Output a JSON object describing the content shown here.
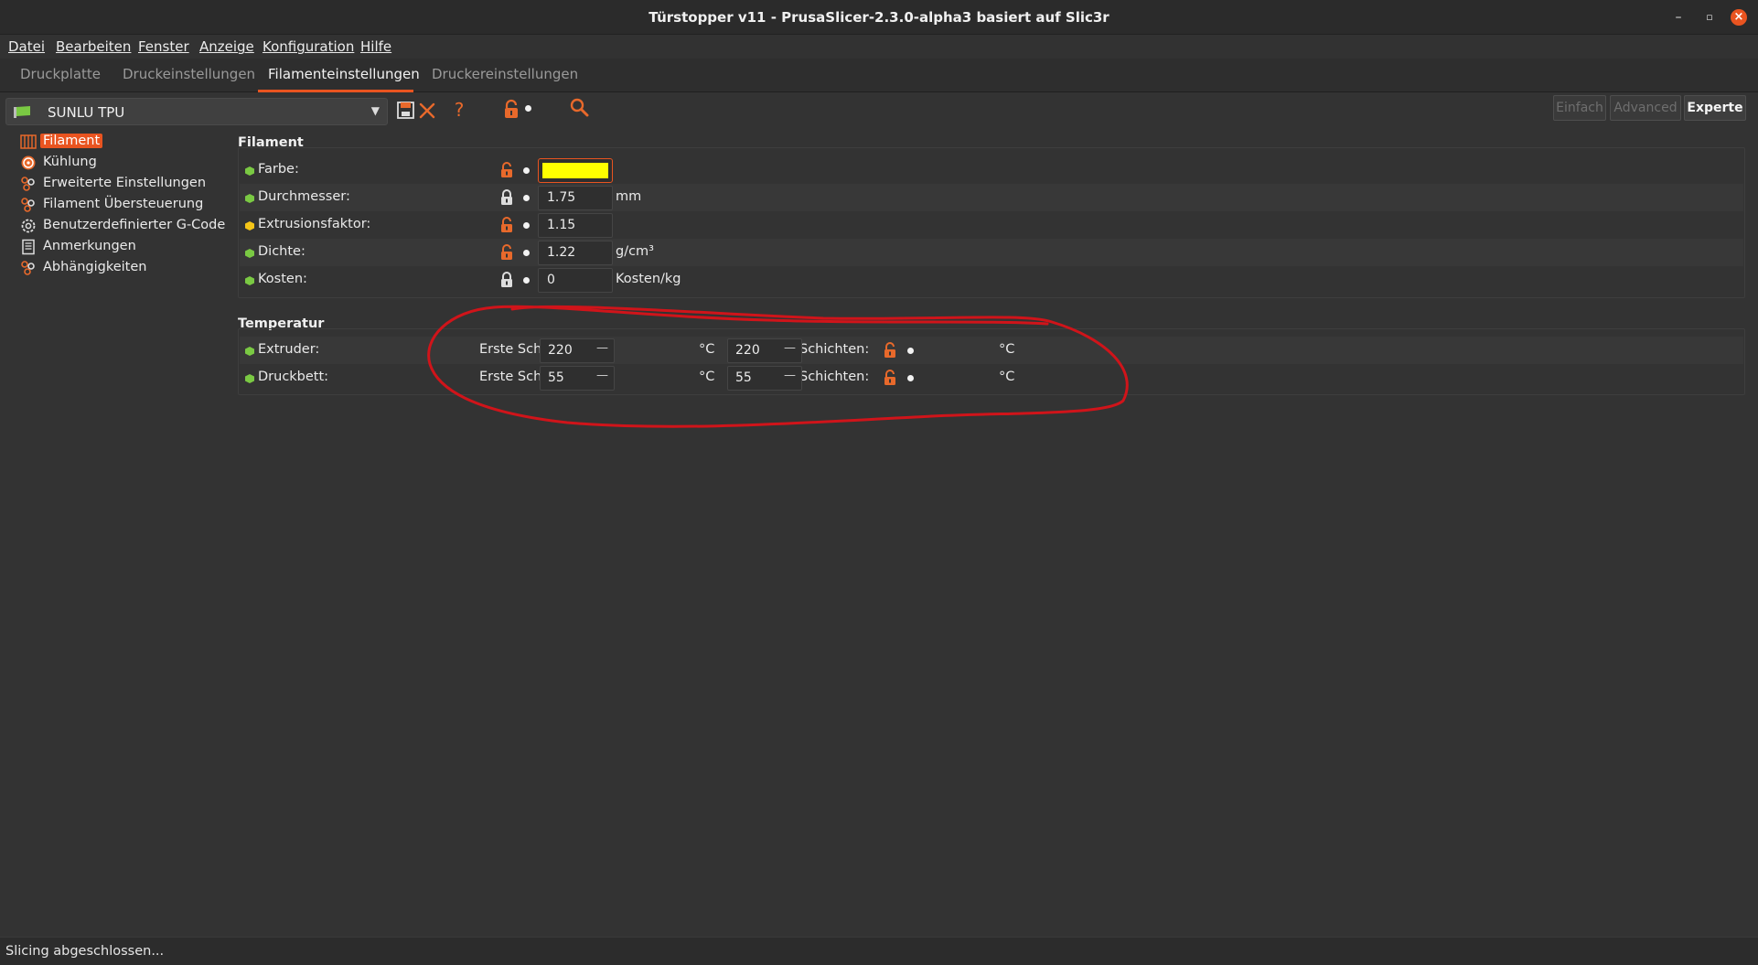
{
  "window": {
    "title": "Türstopper v11 - PrusaSlicer-2.3.0-alpha3 basiert auf Slic3r",
    "controls": [
      "–",
      "▫",
      "×"
    ]
  },
  "menu": [
    "Datei",
    "Bearbeiten",
    "Fenster",
    "Anzeige",
    "Konfiguration",
    "Hilfe"
  ],
  "tabs": [
    "Druckplatte",
    "Druckeinstellungen",
    "Filamenteinstellungen",
    "Druckereinstellungen"
  ],
  "active_tab": "Filamenteinstellungen",
  "preset": {
    "name": "SUNLU TPU"
  },
  "modes": [
    "Einfach",
    "Advanced",
    "Experte"
  ],
  "active_mode": "Experte",
  "sidebar": [
    {
      "label": "Filament",
      "icon": "filament-icon"
    },
    {
      "label": "Kühlung",
      "icon": "cooling-fan-icon"
    },
    {
      "label": "Erweiterte Einstellungen",
      "icon": "advanced-settings-icon"
    },
    {
      "label": "Filament Übersteuerung",
      "icon": "override-icon"
    },
    {
      "label": "Benutzerdefinierter G-Code",
      "icon": "gcode-gear-icon"
    },
    {
      "label": "Anmerkungen",
      "icon": "notes-icon"
    },
    {
      "label": "Abhängigkeiten",
      "icon": "dependencies-icon"
    }
  ],
  "filament_group": {
    "title": "Filament",
    "rows": [
      {
        "label": "Farbe:",
        "value": "",
        "unit": "",
        "dot": "#7ac943",
        "locked": false,
        "swatch": "#ffff00"
      },
      {
        "label": "Durchmesser:",
        "value": "1.75",
        "unit": "mm",
        "dot": "#7ac943",
        "locked": true
      },
      {
        "label": "Extrusionsfaktor:",
        "value": "1.15",
        "unit": "",
        "dot": "#f5c518",
        "locked": false
      },
      {
        "label": "Dichte:",
        "value": "1.22",
        "unit": "g/cm³",
        "dot": "#7ac943",
        "locked": false
      },
      {
        "label": "Kosten:",
        "value": "0",
        "unit": "Kosten/kg",
        "dot": "#7ac943",
        "locked": true
      }
    ]
  },
  "temperature_group": {
    "title": "Temperatur",
    "rows": [
      {
        "label": "Extruder:",
        "first_label": "Erste Schi",
        "first_value": "220",
        "unit": "°C",
        "other_value": "220",
        "other_label": "Schichten:",
        "other_unit": "°C",
        "dot": "#7ac943"
      },
      {
        "label": "Druckbett:",
        "first_label": "Erste Schi",
        "first_value": "55",
        "unit": "°C",
        "other_value": "55",
        "other_label": "Schichten:",
        "other_unit": "°C",
        "dot": "#7ac943"
      }
    ]
  },
  "status": "Slicing abgeschlossen...",
  "colors": {
    "accent": "#e95420",
    "annotation": "#d0141a",
    "lock_orange": "#e8692b",
    "search": "#e8692b"
  }
}
